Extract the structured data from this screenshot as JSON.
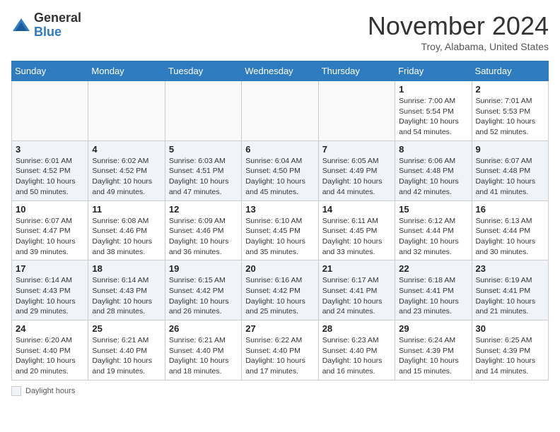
{
  "header": {
    "logo_general": "General",
    "logo_blue": "Blue",
    "month_title": "November 2024",
    "location": "Troy, Alabama, United States"
  },
  "calendar": {
    "days_of_week": [
      "Sunday",
      "Monday",
      "Tuesday",
      "Wednesday",
      "Thursday",
      "Friday",
      "Saturday"
    ],
    "weeks": [
      [
        {
          "day": "",
          "info": ""
        },
        {
          "day": "",
          "info": ""
        },
        {
          "day": "",
          "info": ""
        },
        {
          "day": "",
          "info": ""
        },
        {
          "day": "",
          "info": ""
        },
        {
          "day": "1",
          "info": "Sunrise: 7:00 AM\nSunset: 5:54 PM\nDaylight: 10 hours\nand 54 minutes."
        },
        {
          "day": "2",
          "info": "Sunrise: 7:01 AM\nSunset: 5:53 PM\nDaylight: 10 hours\nand 52 minutes."
        }
      ],
      [
        {
          "day": "3",
          "info": "Sunrise: 6:01 AM\nSunset: 4:52 PM\nDaylight: 10 hours\nand 50 minutes."
        },
        {
          "day": "4",
          "info": "Sunrise: 6:02 AM\nSunset: 4:52 PM\nDaylight: 10 hours\nand 49 minutes."
        },
        {
          "day": "5",
          "info": "Sunrise: 6:03 AM\nSunset: 4:51 PM\nDaylight: 10 hours\nand 47 minutes."
        },
        {
          "day": "6",
          "info": "Sunrise: 6:04 AM\nSunset: 4:50 PM\nDaylight: 10 hours\nand 45 minutes."
        },
        {
          "day": "7",
          "info": "Sunrise: 6:05 AM\nSunset: 4:49 PM\nDaylight: 10 hours\nand 44 minutes."
        },
        {
          "day": "8",
          "info": "Sunrise: 6:06 AM\nSunset: 4:48 PM\nDaylight: 10 hours\nand 42 minutes."
        },
        {
          "day": "9",
          "info": "Sunrise: 6:07 AM\nSunset: 4:48 PM\nDaylight: 10 hours\nand 41 minutes."
        }
      ],
      [
        {
          "day": "10",
          "info": "Sunrise: 6:07 AM\nSunset: 4:47 PM\nDaylight: 10 hours\nand 39 minutes."
        },
        {
          "day": "11",
          "info": "Sunrise: 6:08 AM\nSunset: 4:46 PM\nDaylight: 10 hours\nand 38 minutes."
        },
        {
          "day": "12",
          "info": "Sunrise: 6:09 AM\nSunset: 4:46 PM\nDaylight: 10 hours\nand 36 minutes."
        },
        {
          "day": "13",
          "info": "Sunrise: 6:10 AM\nSunset: 4:45 PM\nDaylight: 10 hours\nand 35 minutes."
        },
        {
          "day": "14",
          "info": "Sunrise: 6:11 AM\nSunset: 4:45 PM\nDaylight: 10 hours\nand 33 minutes."
        },
        {
          "day": "15",
          "info": "Sunrise: 6:12 AM\nSunset: 4:44 PM\nDaylight: 10 hours\nand 32 minutes."
        },
        {
          "day": "16",
          "info": "Sunrise: 6:13 AM\nSunset: 4:44 PM\nDaylight: 10 hours\nand 30 minutes."
        }
      ],
      [
        {
          "day": "17",
          "info": "Sunrise: 6:14 AM\nSunset: 4:43 PM\nDaylight: 10 hours\nand 29 minutes."
        },
        {
          "day": "18",
          "info": "Sunrise: 6:14 AM\nSunset: 4:43 PM\nDaylight: 10 hours\nand 28 minutes."
        },
        {
          "day": "19",
          "info": "Sunrise: 6:15 AM\nSunset: 4:42 PM\nDaylight: 10 hours\nand 26 minutes."
        },
        {
          "day": "20",
          "info": "Sunrise: 6:16 AM\nSunset: 4:42 PM\nDaylight: 10 hours\nand 25 minutes."
        },
        {
          "day": "21",
          "info": "Sunrise: 6:17 AM\nSunset: 4:41 PM\nDaylight: 10 hours\nand 24 minutes."
        },
        {
          "day": "22",
          "info": "Sunrise: 6:18 AM\nSunset: 4:41 PM\nDaylight: 10 hours\nand 23 minutes."
        },
        {
          "day": "23",
          "info": "Sunrise: 6:19 AM\nSunset: 4:41 PM\nDaylight: 10 hours\nand 21 minutes."
        }
      ],
      [
        {
          "day": "24",
          "info": "Sunrise: 6:20 AM\nSunset: 4:40 PM\nDaylight: 10 hours\nand 20 minutes."
        },
        {
          "day": "25",
          "info": "Sunrise: 6:21 AM\nSunset: 4:40 PM\nDaylight: 10 hours\nand 19 minutes."
        },
        {
          "day": "26",
          "info": "Sunrise: 6:21 AM\nSunset: 4:40 PM\nDaylight: 10 hours\nand 18 minutes."
        },
        {
          "day": "27",
          "info": "Sunrise: 6:22 AM\nSunset: 4:40 PM\nDaylight: 10 hours\nand 17 minutes."
        },
        {
          "day": "28",
          "info": "Sunrise: 6:23 AM\nSunset: 4:40 PM\nDaylight: 10 hours\nand 16 minutes."
        },
        {
          "day": "29",
          "info": "Sunrise: 6:24 AM\nSunset: 4:39 PM\nDaylight: 10 hours\nand 15 minutes."
        },
        {
          "day": "30",
          "info": "Sunrise: 6:25 AM\nSunset: 4:39 PM\nDaylight: 10 hours\nand 14 minutes."
        }
      ]
    ]
  },
  "footer": {
    "daylight_label": "Daylight hours"
  }
}
